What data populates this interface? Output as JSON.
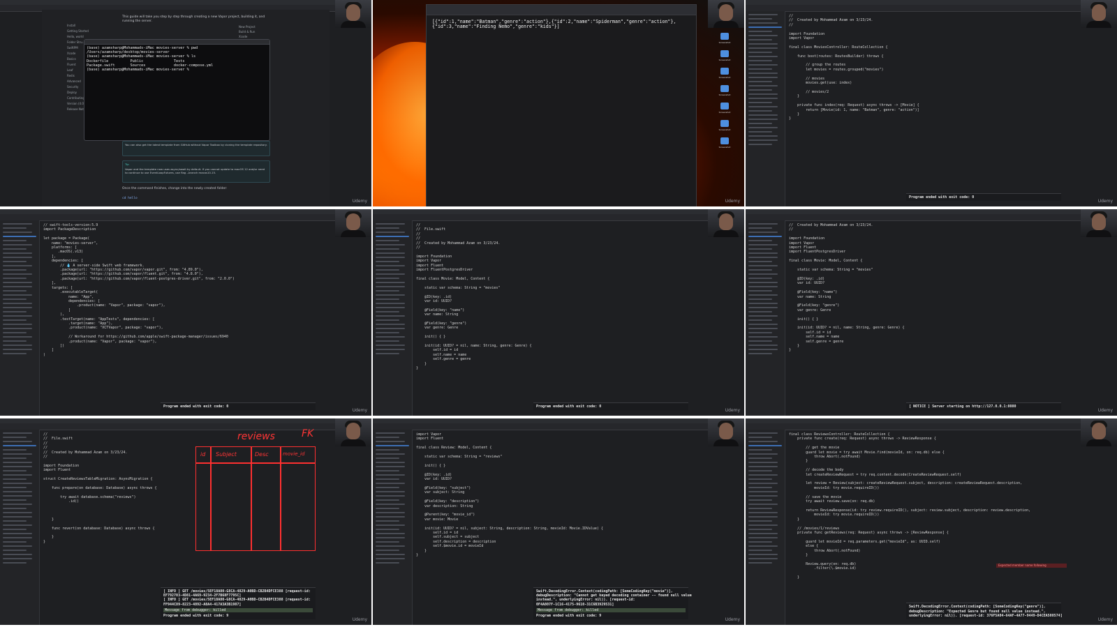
{
  "branding": {
    "watermark": "Udemy"
  },
  "tile1": {
    "intro": "This guide will take you step by step through creating a new Vapor project, building it, and running the server.",
    "nav": [
      "Install",
      "Getting Started",
      "Hello, world",
      "Folder Stru...",
      "SwiftPM",
      "Xcode",
      "Basics",
      "Fluent",
      "Leaf",
      "Redis",
      "Advanced",
      "Security",
      "Deploy",
      "Contributing",
      "Version (4.0)",
      "Release Notes"
    ],
    "right_nav": [
      "New Project",
      "Build & Run",
      "Xcode",
      "Linux",
      "Visit Localhost"
    ],
    "terminal": [
      "(base) azamsharp@Mohammads-iMac movies-server % pwd",
      "/Users/azamsharp/desktop/movies-server",
      "(base) azamsharp@Mohammads-iMac movies-server % ls",
      "Dockerfile          Public              Tests",
      "Package.swift       Sources             docker-compose.yml",
      "(base) azamsharp@Mohammads-iMac movies-server % "
    ],
    "callout1": "You can also get the latest template from GitHub without Vapor Toolbox by cloning the template repository.",
    "tip_label": "Tip",
    "callout2": "Vapor and the template now uses async/await by default. If you cannot update to macOS 12 and/or need to continue to use EventLoopFutures, use flag --branch macos10-15.",
    "after": "Once the command finishes, change into the newly created folder:",
    "cmd": "cd hello"
  },
  "tile2": {
    "json": "[{\"id\":1,\"name\":\"Batman\",\"genre\":\"action\"},{\"id\":2,\"name\":\"Spiderman\",\"genre\":\"action\"},{\"id\":3,\"name\":\"Finding Nemo\",\"genre\":\"kids\"}]",
    "desktop_labels": [
      "Screenshot",
      "Screenshot",
      "Screenshot",
      "Screenshot",
      "Screenshot",
      "Screenshot",
      "Screenshot"
    ]
  },
  "tile3": {
    "code": [
      "//",
      "//  Created by Mohammad Azam on 3/23/24.",
      "//",
      "",
      "import Foundation",
      "import Vapor",
      "",
      "final class MoviesController: RouteCollection {",
      "",
      "    func boot(routes: RoutesBuilder) throws {",
      "",
      "        // group the routes",
      "        let movies = routes.grouped(\"movies\")",
      "",
      "        // movies",
      "        movies.get(use: index)",
      "",
      "        // movies/2",
      "    }",
      "",
      "    private func index(req: Request) async throws -> [Movie] {",
      "        return [Movie(id: 1, name: \"Batman\", genre: \"action\")]",
      "    }",
      "}"
    ],
    "console": "Program ended with exit code: 0"
  },
  "tile4": {
    "code": [
      "// swift-tools-version:5.9",
      "import PackageDescription",
      "",
      "let package = Package(",
      "    name: \"movies-server\",",
      "    platforms: [",
      "       .macOS(.v13)",
      "    ],",
      "    dependencies: [",
      "        // 💧 A server-side Swift web framework.",
      "        .package(url: \"https://github.com/vapor/vapor.git\", from: \"4.89.0\"),",
      "        .package(url: \"https://github.com/vapor/fluent.git\", from: \"4.8.0\"),",
      "        .package(url: \"https://github.com/vapor/fluent-postgres-driver.git\", from: \"2.0.0\")",
      "    ],",
      "    targets: [",
      "        .executableTarget(",
      "            name: \"App\",",
      "            dependencies: [",
      "                .product(name: \"Vapor\", package: \"vapor\"),",
      "            ]",
      "        ),",
      "        .testTarget(name: \"AppTests\", dependencies: [",
      "            .target(name: \"App\"),",
      "            .product(name: \"XCTVapor\", package: \"vapor\"),",
      "",
      "            // Workaround for https://github.com/apple/swift-package-manager/issues/6940",
      "            .product(name: \"Vapor\", package: \"vapor\"),",
      "        ])",
      "    ]",
      ")"
    ],
    "console": "Program ended with exit code: 0"
  },
  "tile5": {
    "code": [
      "//",
      "//  File.swift",
      "//",
      "//",
      "//  Created by Mohammad Azam on 3/23/24.",
      "//",
      "",
      "import Foundation",
      "import Vapor",
      "import Fluent",
      "import FluentPostgresDriver",
      "",
      "final class Movie: Model, Content {",
      "",
      "    static var schema: String = \"movies\"",
      "",
      "    @ID(key: .id)",
      "    var id: UUID?",
      "",
      "    @Field(key: \"name\")",
      "    var name: String",
      "",
      "    @Field(key: \"genre\")",
      "    var genre: Genre",
      "",
      "    init() { }",
      "",
      "    init(id: UUID? = nil, name: String, genre: Genre) {",
      "        self.id = id",
      "        self.name = name",
      "        self.genre = genre",
      "    }",
      "}"
    ],
    "console": "Program ended with exit code: 0"
  },
  "tile6": {
    "code": [
      "//  Created by Mohammad Azam on 3/23/24.",
      "//",
      "",
      "import Foundation",
      "import Vapor",
      "import Fluent",
      "import FluentPostgresDriver",
      "",
      "final class Movie: Model, Content {",
      "",
      "    static var schema: String = \"movies\"",
      "",
      "    @ID(key: .id)",
      "    var id: UUID?",
      "",
      "    @Field(key: \"name\")",
      "    var name: String",
      "",
      "    @Field(key: \"genre\")",
      "    var genre: Genre",
      "",
      "    init() { }",
      "",
      "    init(id: UUID? = nil, name: String, genre: Genre) {",
      "        self.id = id",
      "        self.name = name",
      "        self.genre = genre",
      "    }",
      "}"
    ],
    "console": "[ NOTICE ] Server starting on http://127.0.0.1:8080"
  },
  "tile7": {
    "code": [
      "//",
      "//  File.swift",
      "//",
      "//",
      "//  Created by Mohammad Azam on 3/23/24.",
      "//",
      "",
      "import Foundation",
      "import Fluent",
      "",
      "struct CreateReviewsTableMigration: AsyncMigration {",
      "",
      "    func prepare(on database: Database) async throws {",
      "",
      "        try await database.schema(\"reviews\")",
      "            .id()",
      "",
      "",
      "",
      "    }",
      "",
      "    func revert(on database: Database) async throws {",
      "",
      "    }",
      "}"
    ],
    "drawing": {
      "title": "reviews",
      "fk": "FK",
      "cols": [
        "id",
        "Subject",
        "Desc",
        "movie_id"
      ]
    },
    "console": [
      "[ INFO ] GET /movies/5EF18A80-G8CA-4829-A0BD-CB2B4DFCE388 [request-id:",
      "EF792703-4D81-4A69-9234-2F7B68F7795C]",
      "[ INFO ] GET /movies/5EF18A80-G8CA-4829-A0BD-CB2B4DFCE388 [request-id:",
      "FF944C89-8223-4892-A8A4-417A3A3B1987]"
    ],
    "debugger": "Message from debugger: killed",
    "exit": "Program ended with exit code: 9"
  },
  "tile8": {
    "code": [
      "import Vapor",
      "import Fluent",
      "",
      "final class Review: Model, Content {",
      "",
      "    static var schema: String = \"reviews\"",
      "",
      "    init() { }",
      "",
      "    @ID(key: .id)",
      "    var id: UUID?",
      "",
      "    @Field(key: \"subject\")",
      "    var subject: String",
      "",
      "    @Field(key: \"description\")",
      "    var description: String",
      "",
      "    @Parent(key: \"movie_id\")",
      "    var movie: Movie",
      "",
      "    init(id: UUID? = nil, subject: String, description: String, movieId: Movie.IDValue) {",
      "        self.id = id",
      "        self.subject = subject",
      "        self.description = description",
      "        self.$movie.id = movieId",
      "    }",
      "}"
    ],
    "console": [
      "Swift.DecodingError.Context(codingPath: [SomeCodingKey(\"movie\")],",
      "debugDescription: \"Cannot get keyed decoding container -- found null value",
      "instead.\", underlyingError: nil)). [request-id:",
      "0F4A807F-1C16-4175-9610-31C6B3929531]"
    ],
    "debugger": "Message from debugger: killed",
    "exit": "Program ended with exit code: 9"
  },
  "tile9": {
    "code": [
      "final class ReviewsController: RouteCollection {",
      "    private func create(req: Request) async throws -> ReviewResponse {",
      "",
      "        // get the movie",
      "        guard let movie = try await Movie.find(movieId, on: req.db) else {",
      "            throw Abort(.notFound)",
      "        }",
      "",
      "        // decode the body",
      "        let createReviewRequest = try req.content.decode(CreateReviewRequest.self)",
      "",
      "        let review = Review(subject: createReviewRequest.subject, description: createReviewRequest.description,",
      "            movieId: try movie.requireID())",
      "",
      "        // save the movie",
      "        try await review.save(on: req.db)",
      "",
      "        return ReviewResponse(id: try review.requireID(), subject: review.subject, description: review.description,",
      "            movieId: try movie.requireID())",
      "    }",
      "",
      "    // /movies/1/reviews",
      "    private func getReviews(req: Request) async throws -> [ReviewResponse] {",
      "",
      "        guard let movieId = req.parameters.get(\"movieId\", as: UUID.self)",
      "        else {",
      "            throw Abort(.notFound)",
      "        }",
      "",
      "        Review.query(on: req.db)",
      "            .filter(\\.$movie.id)",
      "",
      "    }"
    ],
    "error": "Expected member name following",
    "console": [
      "Swift.DecodingError.Context(codingPath: [SomeCodingKey(\"genre\")],",
      "debugDescription: \"Expected Genre but found null value instead.\",",
      "underlyingError: nil)). [request-id: 376F5A04-64AF-4A77-9449-D4CEA508574]"
    ]
  }
}
